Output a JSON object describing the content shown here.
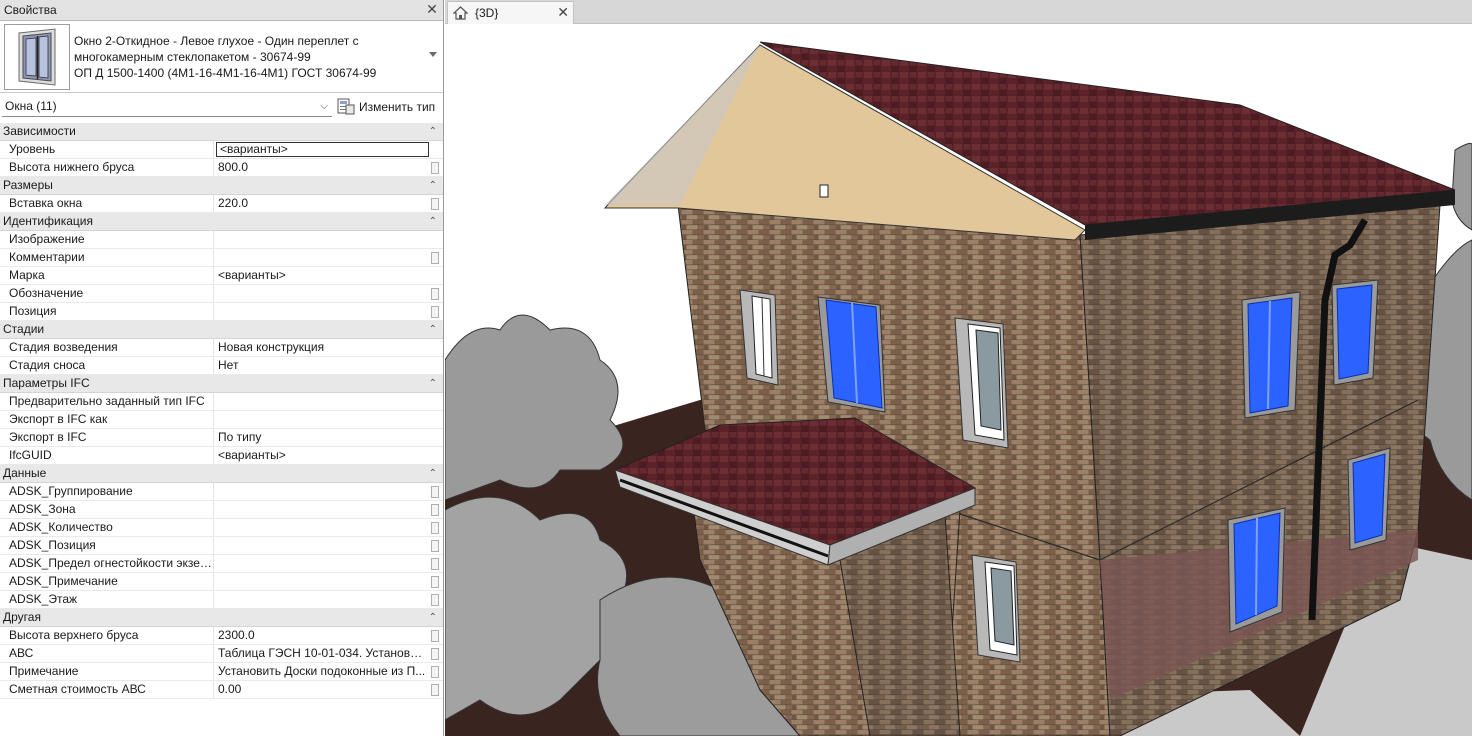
{
  "properties_panel": {
    "title": "Свойства",
    "type_selector": {
      "line1": "Окно 2-Откидное - Левое глухое - Один переплет с",
      "line2": "многокамерным стеклопакетом - 30674-99",
      "line3": "ОП Д  1500-1400 (4М1-16-4М1-16-4М1)  ГОСТ 30674-99"
    },
    "filter": "Окна (11)",
    "edit_type_label": "Изменить тип",
    "sections": [
      {
        "title": "Зависимости",
        "rows": [
          {
            "name": "Уровень",
            "value": "<варианты>",
            "selected": true
          },
          {
            "name": "Высота нижнего бруса",
            "value": "800.0",
            "btn": true
          }
        ]
      },
      {
        "title": "Размеры",
        "rows": [
          {
            "name": "Вставка окна",
            "value": "220.0",
            "btn": true
          }
        ]
      },
      {
        "title": "Идентификация",
        "rows": [
          {
            "name": "Изображение",
            "value": ""
          },
          {
            "name": "Комментарии",
            "value": "",
            "btn": true
          },
          {
            "name": "Марка",
            "value": "<варианты>"
          },
          {
            "name": "Обозначение",
            "value": "",
            "btn": true
          },
          {
            "name": "Позиция",
            "value": "",
            "btn": true
          }
        ]
      },
      {
        "title": "Стадии",
        "rows": [
          {
            "name": "Стадия возведения",
            "value": "Новая конструкция"
          },
          {
            "name": "Стадия сноса",
            "value": "Нет"
          }
        ]
      },
      {
        "title": "Параметры IFC",
        "rows": [
          {
            "name": "Предварительно заданный тип IFC",
            "value": ""
          },
          {
            "name": "Экспорт в IFC как",
            "value": ""
          },
          {
            "name": "Экспорт в IFC",
            "value": "По типу"
          },
          {
            "name": "IfcGUID",
            "value": "<варианты>"
          }
        ]
      },
      {
        "title": "Данные",
        "rows": [
          {
            "name": "ADSK_Группирование",
            "value": "",
            "btn": true
          },
          {
            "name": "ADSK_Зона",
            "value": "",
            "btn": true
          },
          {
            "name": "ADSK_Количество",
            "value": "",
            "btn": true
          },
          {
            "name": "ADSK_Позиция",
            "value": "",
            "btn": true
          },
          {
            "name": "ADSK_Предел огнестойкости экзем...",
            "value": "",
            "btn": true
          },
          {
            "name": "ADSK_Примечание",
            "value": "",
            "btn": true
          },
          {
            "name": "ADSK_Этаж",
            "value": "",
            "btn": true
          }
        ]
      },
      {
        "title": "Другая",
        "rows": [
          {
            "name": "Высота верхнего бруса",
            "value": "2300.0",
            "btn": true
          },
          {
            "name": "АВС",
            "value": "Таблица ГЭСН 10-01-034. Установка ...",
            "btn": true
          },
          {
            "name": "Примечание",
            "value": "Установить Доски подоконные из П...",
            "btn": true
          },
          {
            "name": "Сметная стоимость АВС",
            "value": "0.00",
            "btn": true
          }
        ]
      }
    ]
  },
  "view_tab": {
    "label": "{3D}"
  },
  "icons": {
    "close": "close-icon",
    "home": "home-icon",
    "collapse": "collapse-icon",
    "edit_type": "edit-type-icon"
  },
  "colors": {
    "brick": "#8a6e56",
    "roof": "#5b2329",
    "fascia": "#e2c79a",
    "window_highlight": "#2a63ff",
    "ground": "#3a2420",
    "tree": "#9a9a9a"
  }
}
